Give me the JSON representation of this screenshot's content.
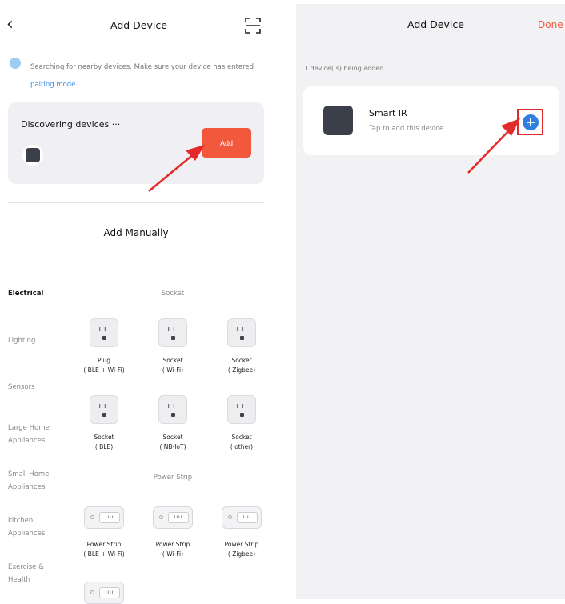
{
  "left": {
    "title": "Add Device",
    "back_icon": "chevron-left-icon",
    "scan_icon": "scan-icon",
    "info_text": "Searching for nearby devices. Make sure your device has entered",
    "info_link": "pairing mode.",
    "discovering_title": "Discovering devices",
    "discovering_suffix": "···",
    "add_label": "Add",
    "manual_title": "Add Manually",
    "categories": [
      "Electrical",
      "Lighting",
      "Sensors",
      "Large Home Appliances",
      "Small Home Appliances",
      "kitchen Appliances",
      "Exercise & Health"
    ],
    "sections": {
      "socket": "Socket",
      "power_strip": "Power Strip"
    },
    "socket_items": [
      {
        "name": "Plug",
        "sub": "( BLE + Wi-Fi)"
      },
      {
        "name": "Socket",
        "sub": "( Wi-Fi)"
      },
      {
        "name": "Socket",
        "sub": "( Zigbee)"
      },
      {
        "name": "Socket",
        "sub": "( BLE)"
      },
      {
        "name": "Socket",
        "sub": "( NB-IoT)"
      },
      {
        "name": "Socket",
        "sub": "( other)"
      }
    ],
    "strip_items": [
      {
        "name": "Power Strip",
        "sub": "( BLE + Wi-Fi)"
      },
      {
        "name": "Power Strip",
        "sub": "( Wi-Fi)"
      },
      {
        "name": "Power Strip",
        "sub": "( Zigbee)"
      }
    ]
  },
  "right": {
    "title": "Add Device",
    "done_label": "Done",
    "count_text": "1 device( s) being added",
    "device_name": "Smart IR",
    "device_sub": "Tap to add this device",
    "plus_icon": "plus-circle-icon"
  },
  "colors": {
    "accent": "#f2583c",
    "highlight": "#e32a2a",
    "link": "#3a8ee0",
    "plus": "#2f7fe0"
  }
}
